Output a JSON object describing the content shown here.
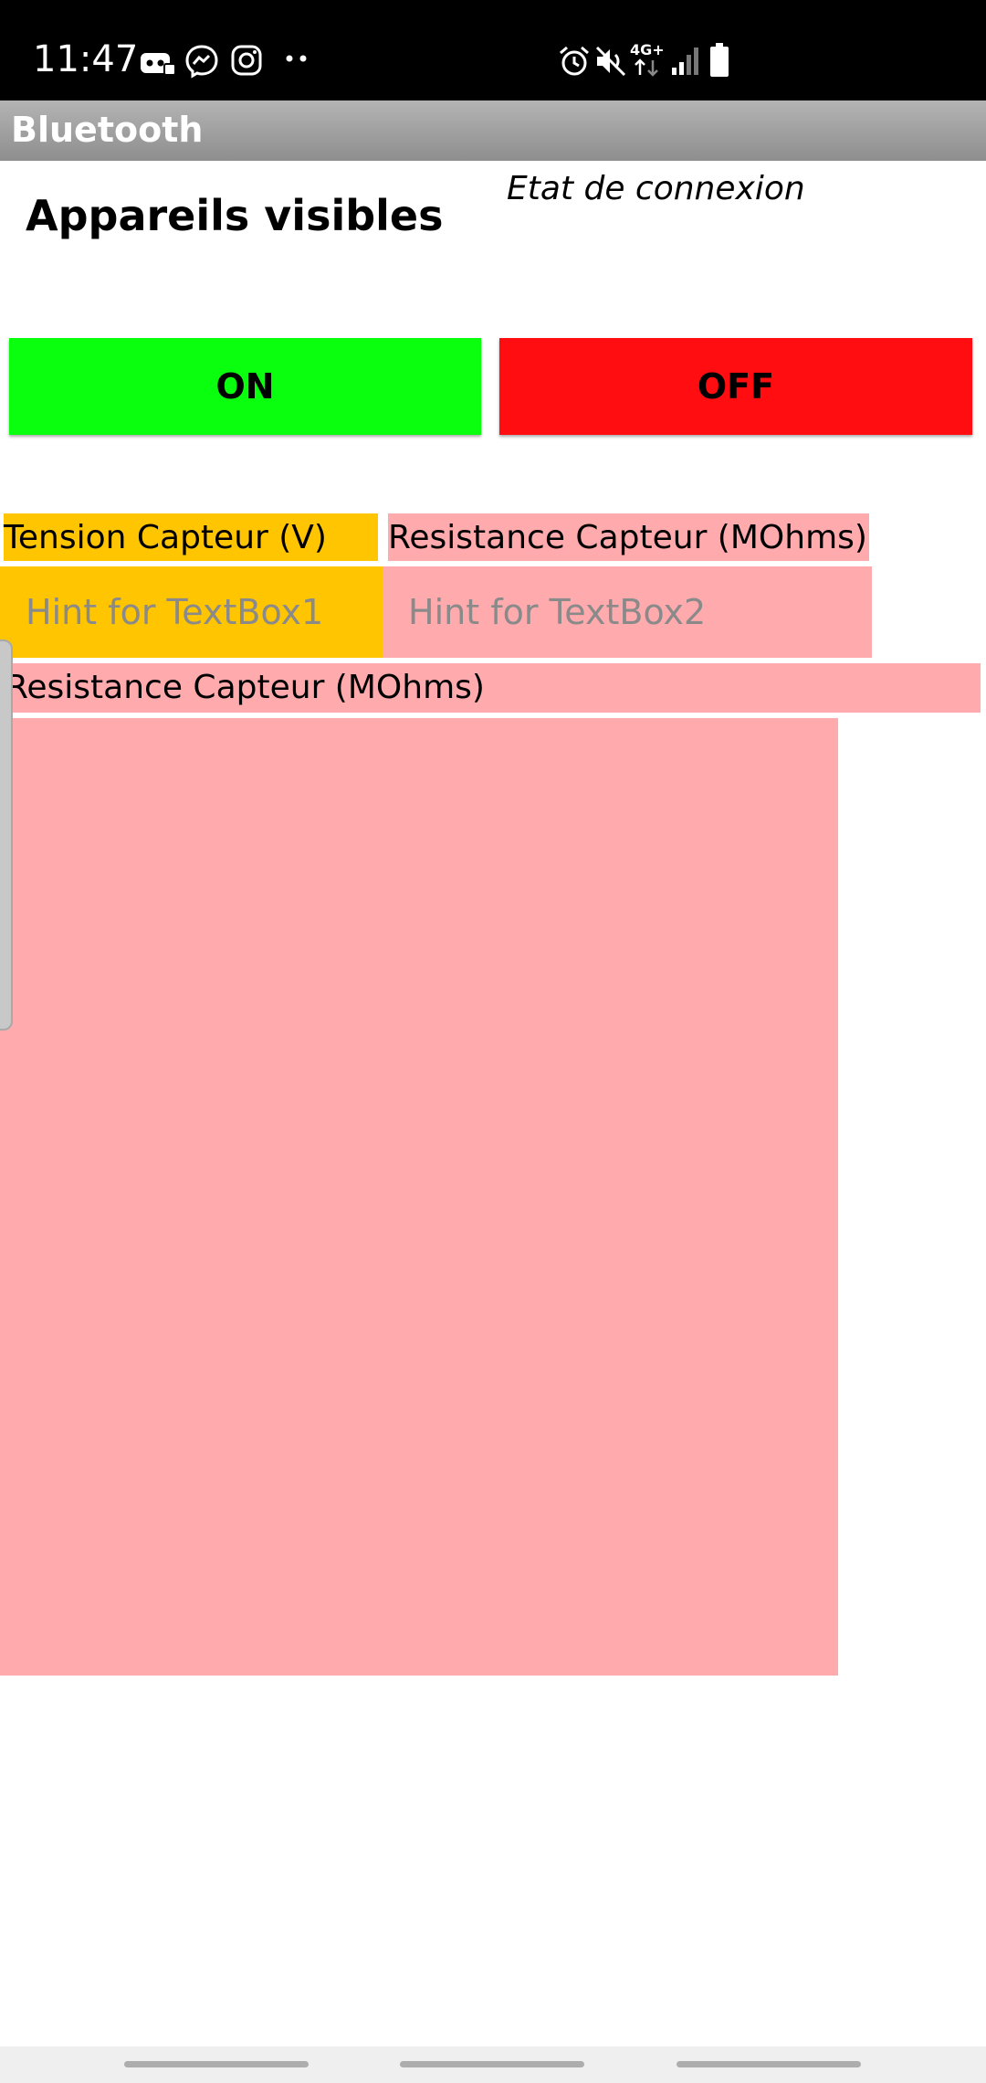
{
  "status_bar": {
    "time": "11:47",
    "left_icons": [
      "discord-icon",
      "messenger-icon",
      "instagram-icon",
      "more-dots-icon"
    ],
    "right_icons": [
      "alarm-icon",
      "mute-icon",
      "network-4g-icon",
      "signal-icon",
      "battery-icon"
    ],
    "network_label": "4G+"
  },
  "app": {
    "title": "Bluetooth"
  },
  "header": {
    "heading": "Appareils visibles",
    "connection_state": "Etat de connexion"
  },
  "buttons": {
    "on_label": "ON",
    "off_label": "OFF"
  },
  "labels": {
    "tension": "Tension Capteur (V)",
    "resistance_top": "Resistance Capteur (MOhms)",
    "resistance_full": "Resistance Capteur (MOhms)"
  },
  "textboxes": {
    "tb1_placeholder": "Hint for TextBox1",
    "tb2_placeholder": "Hint for TextBox2"
  },
  "colors": {
    "on_button": "#09ff0d",
    "off_button": "#ff0d10",
    "orange": "#ffc501",
    "pink": "#ffaaad",
    "title_bar": "#9e9e9e"
  }
}
